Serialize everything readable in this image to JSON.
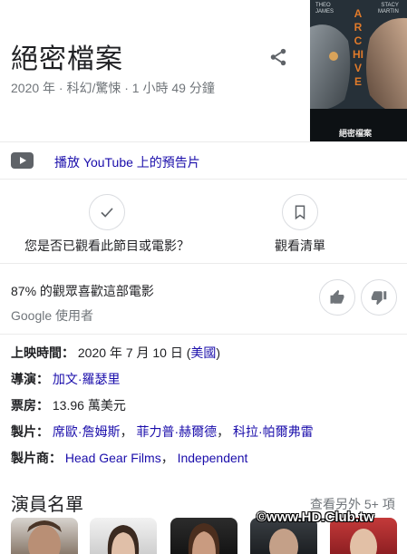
{
  "movie": {
    "title": "絕密檔案",
    "meta": "2020 年 · 科幻/驚悚 · 1 小時 49 分鐘"
  },
  "poster": {
    "actor_left": "THEO\nJAMES",
    "actor_right": "STACY\nMARTIN",
    "word": "ARCHIVE",
    "caption": "絕密檔案"
  },
  "trailer": {
    "label": "播放 YouTube 上的預告片"
  },
  "actions": {
    "seen_question": "您是否已觀看此節目或電影？",
    "watchlist": "觀看清單"
  },
  "rating": {
    "percent_text": "87% 的觀眾喜歡這部電影",
    "source": "Google 使用者"
  },
  "info": {
    "release_label": "上映時間：",
    "release_value": "2020 年 7 月 10 日 (",
    "release_country": "美國",
    "release_close": ")",
    "director_label": "導演：",
    "director": "加文·羅瑟里",
    "boxoffice_label": "票房：",
    "boxoffice": "13.96 萬美元",
    "producers_label": "製片：",
    "producers": [
      "席歐·詹姆斯",
      "菲力普·赫爾德",
      "科拉·帕爾弗雷"
    ],
    "companies_label": "製片商：",
    "companies": [
      "Head Gear Films",
      "Independent"
    ],
    "separator": "，"
  },
  "cast": {
    "title": "演員名單",
    "more": "查看另外 5+ 項"
  },
  "watermark": "©www.HD.Club.tw",
  "colors": {
    "link": "#1a0dab",
    "text": "#202124",
    "muted": "#70757a"
  }
}
